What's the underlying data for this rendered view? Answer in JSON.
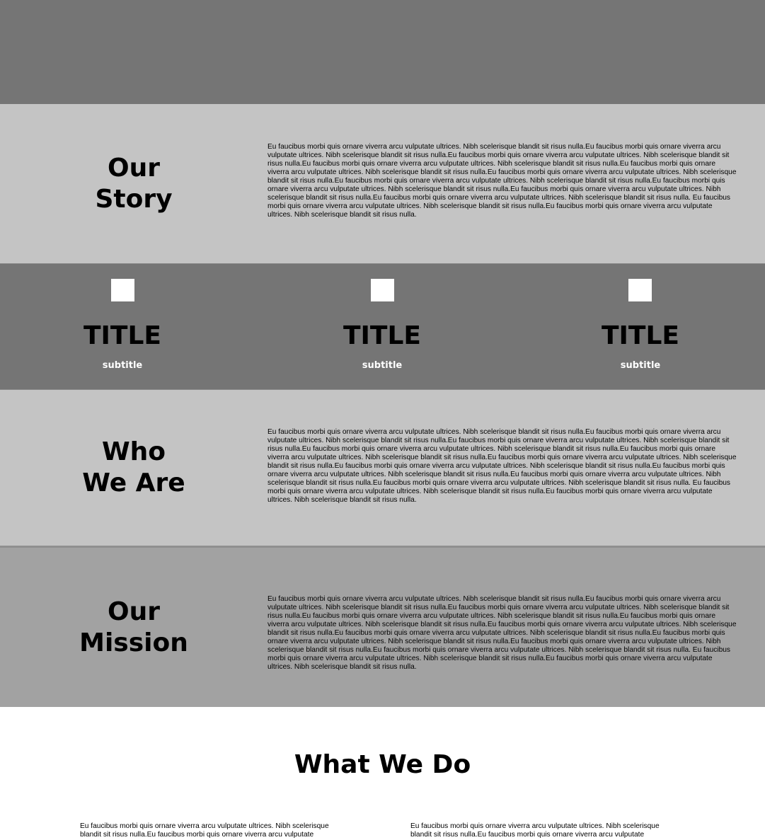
{
  "story": {
    "heading": "Our\nStory",
    "body": "Eu faucibus morbi quis ornare viverra arcu vulputate ultrices. Nibh scelerisque blandit sit risus nulla.Eu faucibus morbi quis ornare viverra arcu vulputate ultrices. Nibh scelerisque blandit sit risus nulla.Eu faucibus morbi quis ornare viverra arcu vulputate ultrices. Nibh scelerisque blandit sit risus nulla.Eu faucibus morbi quis ornare viverra arcu vulputate ultrices. Nibh scelerisque blandit sit risus nulla.Eu faucibus morbi quis ornare viverra arcu vulputate ultrices. Nibh scelerisque blandit sit risus nulla.Eu faucibus morbi quis ornare viverra arcu vulputate ultrices. Nibh scelerisque blandit sit risus nulla.Eu faucibus morbi quis ornare viverra arcu vulputate ultrices. Nibh scelerisque blandit sit risus nulla.Eu faucibus morbi quis ornare viverra arcu vulputate ultrices. Nibh scelerisque blandit sit risus nulla.Eu faucibus morbi quis ornare viverra arcu vulputate ultrices. Nibh scelerisque blandit sit risus nulla.Eu faucibus morbi quis ornare viverra arcu vulputate ultrices. Nibh scelerisque blandit sit risus nulla. Eu faucibus morbi quis ornare viverra arcu vulputate ultrices. Nibh scelerisque blandit sit risus nulla.Eu faucibus morbi quis ornare viverra arcu vulputate ultrices. Nibh scelerisque blandit sit risus nulla."
  },
  "features": [
    {
      "title": "TITLE",
      "subtitle": "subtitle"
    },
    {
      "title": "TITLE",
      "subtitle": "subtitle"
    },
    {
      "title": "TITLE",
      "subtitle": "subtitle"
    }
  ],
  "who": {
    "heading": "Who\nWe Are",
    "body": "Eu faucibus morbi quis ornare viverra arcu vulputate ultrices. Nibh scelerisque blandit sit risus nulla.Eu faucibus morbi quis ornare viverra arcu vulputate ultrices. Nibh scelerisque blandit sit risus nulla.Eu faucibus morbi quis ornare viverra arcu vulputate ultrices. Nibh scelerisque blandit sit risus nulla.Eu faucibus morbi quis ornare viverra arcu vulputate ultrices. Nibh scelerisque blandit sit risus nulla.Eu faucibus morbi quis ornare viverra arcu vulputate ultrices. Nibh scelerisque blandit sit risus nulla.Eu faucibus morbi quis ornare viverra arcu vulputate ultrices. Nibh scelerisque blandit sit risus nulla.Eu faucibus morbi quis ornare viverra arcu vulputate ultrices. Nibh scelerisque blandit sit risus nulla.Eu faucibus morbi quis ornare viverra arcu vulputate ultrices. Nibh scelerisque blandit sit risus nulla.Eu faucibus morbi quis ornare viverra arcu vulputate ultrices. Nibh scelerisque blandit sit risus nulla.Eu faucibus morbi quis ornare viverra arcu vulputate ultrices. Nibh scelerisque blandit sit risus nulla. Eu faucibus morbi quis ornare viverra arcu vulputate ultrices. Nibh scelerisque blandit sit risus nulla.Eu faucibus morbi quis ornare viverra arcu vulputate ultrices. Nibh scelerisque blandit sit risus nulla."
  },
  "mission": {
    "heading": "Our\nMission",
    "body": "Eu faucibus morbi quis ornare viverra arcu vulputate ultrices. Nibh scelerisque blandit sit risus nulla.Eu faucibus morbi quis ornare viverra arcu vulputate ultrices. Nibh scelerisque blandit sit risus nulla.Eu faucibus morbi quis ornare viverra arcu vulputate ultrices. Nibh scelerisque blandit sit risus nulla.Eu faucibus morbi quis ornare viverra arcu vulputate ultrices. Nibh scelerisque blandit sit risus nulla.Eu faucibus morbi quis ornare viverra arcu vulputate ultrices. Nibh scelerisque blandit sit risus nulla.Eu faucibus morbi quis ornare viverra arcu vulputate ultrices. Nibh scelerisque blandit sit risus nulla.Eu faucibus morbi quis ornare viverra arcu vulputate ultrices. Nibh scelerisque blandit sit risus nulla.Eu faucibus morbi quis ornare viverra arcu vulputate ultrices. Nibh scelerisque blandit sit risus nulla.Eu faucibus morbi quis ornare viverra arcu vulputate ultrices. Nibh scelerisque blandit sit risus nulla.Eu faucibus morbi quis ornare viverra arcu vulputate ultrices. Nibh scelerisque blandit sit risus nulla. Eu faucibus morbi quis ornare viverra arcu vulputate ultrices. Nibh scelerisque blandit sit risus nulla.Eu faucibus morbi quis ornare viverra arcu vulputate ultrices. Nibh scelerisque blandit sit risus nulla."
  },
  "what_we_do": {
    "heading": "What We Do",
    "columns": [
      "Eu faucibus morbi quis ornare viverra arcu vulputate ultrices. Nibh scelerisque blandit sit risus nulla.Eu faucibus morbi quis ornare viverra arcu vulputate",
      "Eu faucibus morbi quis ornare viverra arcu vulputate ultrices. Nibh scelerisque blandit sit risus nulla.Eu faucibus morbi quis ornare viverra arcu vulputate"
    ]
  }
}
